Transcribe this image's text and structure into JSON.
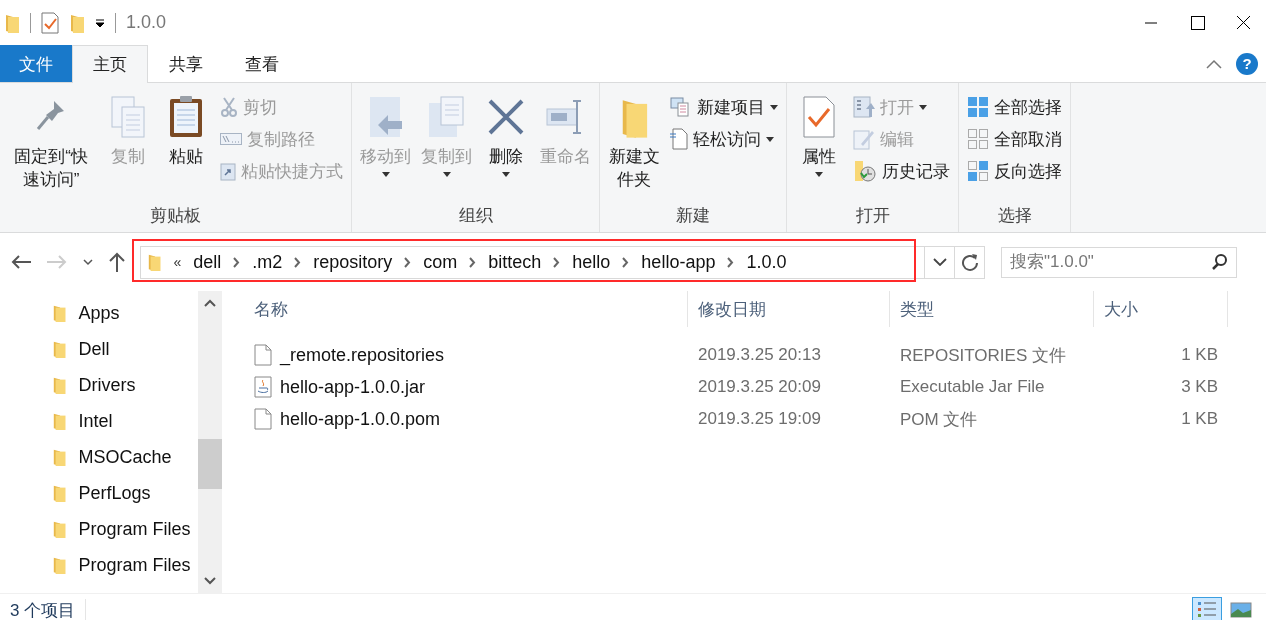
{
  "window": {
    "title": "1.0.0"
  },
  "tabs": [
    {
      "label": "文件",
      "kind": "file",
      "selected": false
    },
    {
      "label": "主页",
      "kind": "tab",
      "selected": true
    },
    {
      "label": "共享",
      "kind": "tab",
      "selected": false
    },
    {
      "label": "查看",
      "kind": "tab",
      "selected": false
    }
  ],
  "help": "?",
  "ribbon": [
    {
      "label": "剪贴板",
      "items": [
        {
          "label": "固定到“快速访问”",
          "kind": "large",
          "disabled": false,
          "dropdown": false
        },
        {
          "label": "复制",
          "kind": "large",
          "disabled": true,
          "dropdown": false
        },
        {
          "label": "粘贴",
          "kind": "large",
          "disabled": false,
          "dropdown": false
        },
        {
          "label": "剪切",
          "kind": "small",
          "disabled": true,
          "dropdown": false
        },
        {
          "label": "复制路径",
          "kind": "small",
          "disabled": true,
          "dropdown": false
        },
        {
          "label": "粘贴快捷方式",
          "kind": "small",
          "disabled": true,
          "dropdown": false
        }
      ]
    },
    {
      "label": "组织",
      "items": [
        {
          "label": "移动到",
          "kind": "large",
          "disabled": true,
          "dropdown": true
        },
        {
          "label": "复制到",
          "kind": "large",
          "disabled": true,
          "dropdown": true
        },
        {
          "label": "删除",
          "kind": "large",
          "disabled": false,
          "dropdown": true
        },
        {
          "label": "重命名",
          "kind": "large",
          "disabled": true,
          "dropdown": false
        }
      ]
    },
    {
      "label": "新建",
      "items": [
        {
          "label": "新建文件夹",
          "kind": "large",
          "disabled": false,
          "dropdown": false
        },
        {
          "label": "新建项目",
          "kind": "small",
          "disabled": false,
          "dropdown": true
        },
        {
          "label": "轻松访问",
          "kind": "small",
          "disabled": false,
          "dropdown": true
        }
      ]
    },
    {
      "label": "打开",
      "items": [
        {
          "label": "属性",
          "kind": "large",
          "disabled": false,
          "dropdown": true
        },
        {
          "label": "打开",
          "kind": "small",
          "disabled": true,
          "dropdown": true
        },
        {
          "label": "编辑",
          "kind": "small",
          "disabled": true,
          "dropdown": false
        },
        {
          "label": "历史记录",
          "kind": "small",
          "disabled": false,
          "dropdown": false
        }
      ]
    },
    {
      "label": "选择",
      "items": [
        {
          "label": "全部选择",
          "kind": "small",
          "disabled": false,
          "dropdown": false
        },
        {
          "label": "全部取消",
          "kind": "small",
          "disabled": false,
          "dropdown": false
        },
        {
          "label": "反向选择",
          "kind": "small",
          "disabled": false,
          "dropdown": false
        }
      ]
    }
  ],
  "address": {
    "overflow": "«",
    "highlighted": true,
    "path": [
      "dell",
      ".m2",
      "repository",
      "com",
      "bittech",
      "hello",
      "hello-app",
      "1.0.0"
    ]
  },
  "search": {
    "placeholder": "搜索\"1.0.0\""
  },
  "sidebar": {
    "items": [
      "Apps",
      "Dell",
      "Drivers",
      "Intel",
      "MSOCache",
      "PerfLogs",
      "Program Files",
      "Program Files"
    ]
  },
  "table": {
    "columns": [
      "名称",
      "修改日期",
      "类型",
      "大小"
    ],
    "rows": [
      {
        "kind": "file",
        "name": "_remote.repositories",
        "date": "2019.3.25 20:13",
        "type": "REPOSITORIES 文件",
        "size": "1 KB"
      },
      {
        "kind": "jar",
        "name": "hello-app-1.0.0.jar",
        "date": "2019.3.25 20:09",
        "type": "Executable Jar File",
        "size": "3 KB"
      },
      {
        "kind": "file",
        "name": "hello-app-1.0.0.pom",
        "date": "2019.3.25 19:09",
        "type": "POM 文件",
        "size": "1 KB"
      }
    ]
  },
  "status_bar": {
    "count": "3 个项目",
    "views": [
      {
        "kind": "details",
        "selected": true
      },
      {
        "kind": "large-icons",
        "selected": false
      }
    ]
  }
}
